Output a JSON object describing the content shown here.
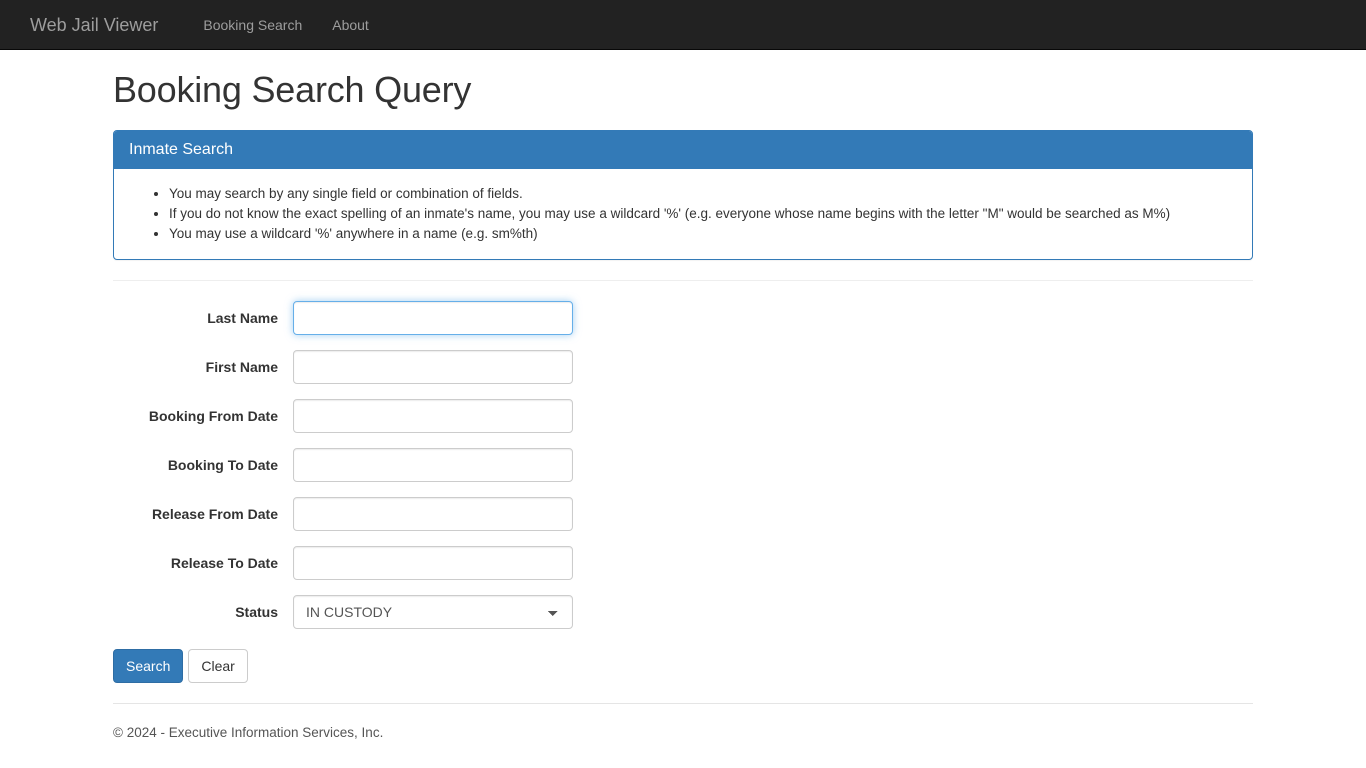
{
  "navbar": {
    "brand": "Web Jail Viewer",
    "links": [
      {
        "label": "Booking Search",
        "name": "nav-link-booking-search"
      },
      {
        "label": "About",
        "name": "nav-link-about"
      }
    ],
    "background_color": "#222222",
    "text_color": "#9d9d9d"
  },
  "page": {
    "title": "Booking Search Query"
  },
  "panel": {
    "heading": "Inmate Search",
    "accent_color": "#337ab7",
    "bullets": [
      "You may search by any single field or combination of fields.",
      "If you do not know the exact spelling of an inmate's name, you may use a wildcard '%' (e.g. everyone whose name begins with the letter \"M\" would be searched as M%)",
      "You may use a wildcard '%' anywhere in a name (e.g. sm%th)"
    ]
  },
  "form": {
    "fields": [
      {
        "label": "Last Name",
        "value": "",
        "placeholder": "",
        "type": "text",
        "focused": true
      },
      {
        "label": "First Name",
        "value": "",
        "placeholder": "",
        "type": "text",
        "focused": false
      },
      {
        "label": "Booking From Date",
        "value": "",
        "placeholder": "",
        "type": "text",
        "focused": false
      },
      {
        "label": "Booking To Date",
        "value": "",
        "placeholder": "",
        "type": "text",
        "focused": false
      },
      {
        "label": "Release From Date",
        "value": "",
        "placeholder": "",
        "type": "text",
        "focused": false
      },
      {
        "label": "Release To Date",
        "value": "",
        "placeholder": "",
        "type": "text",
        "focused": false
      }
    ],
    "status": {
      "label": "Status",
      "selected": "IN CUSTODY",
      "options": [
        "IN CUSTODY"
      ]
    },
    "buttons": {
      "search": "Search",
      "clear": "Clear"
    }
  },
  "footer": {
    "copyright": "© 2024 - Executive Information Services, Inc."
  }
}
